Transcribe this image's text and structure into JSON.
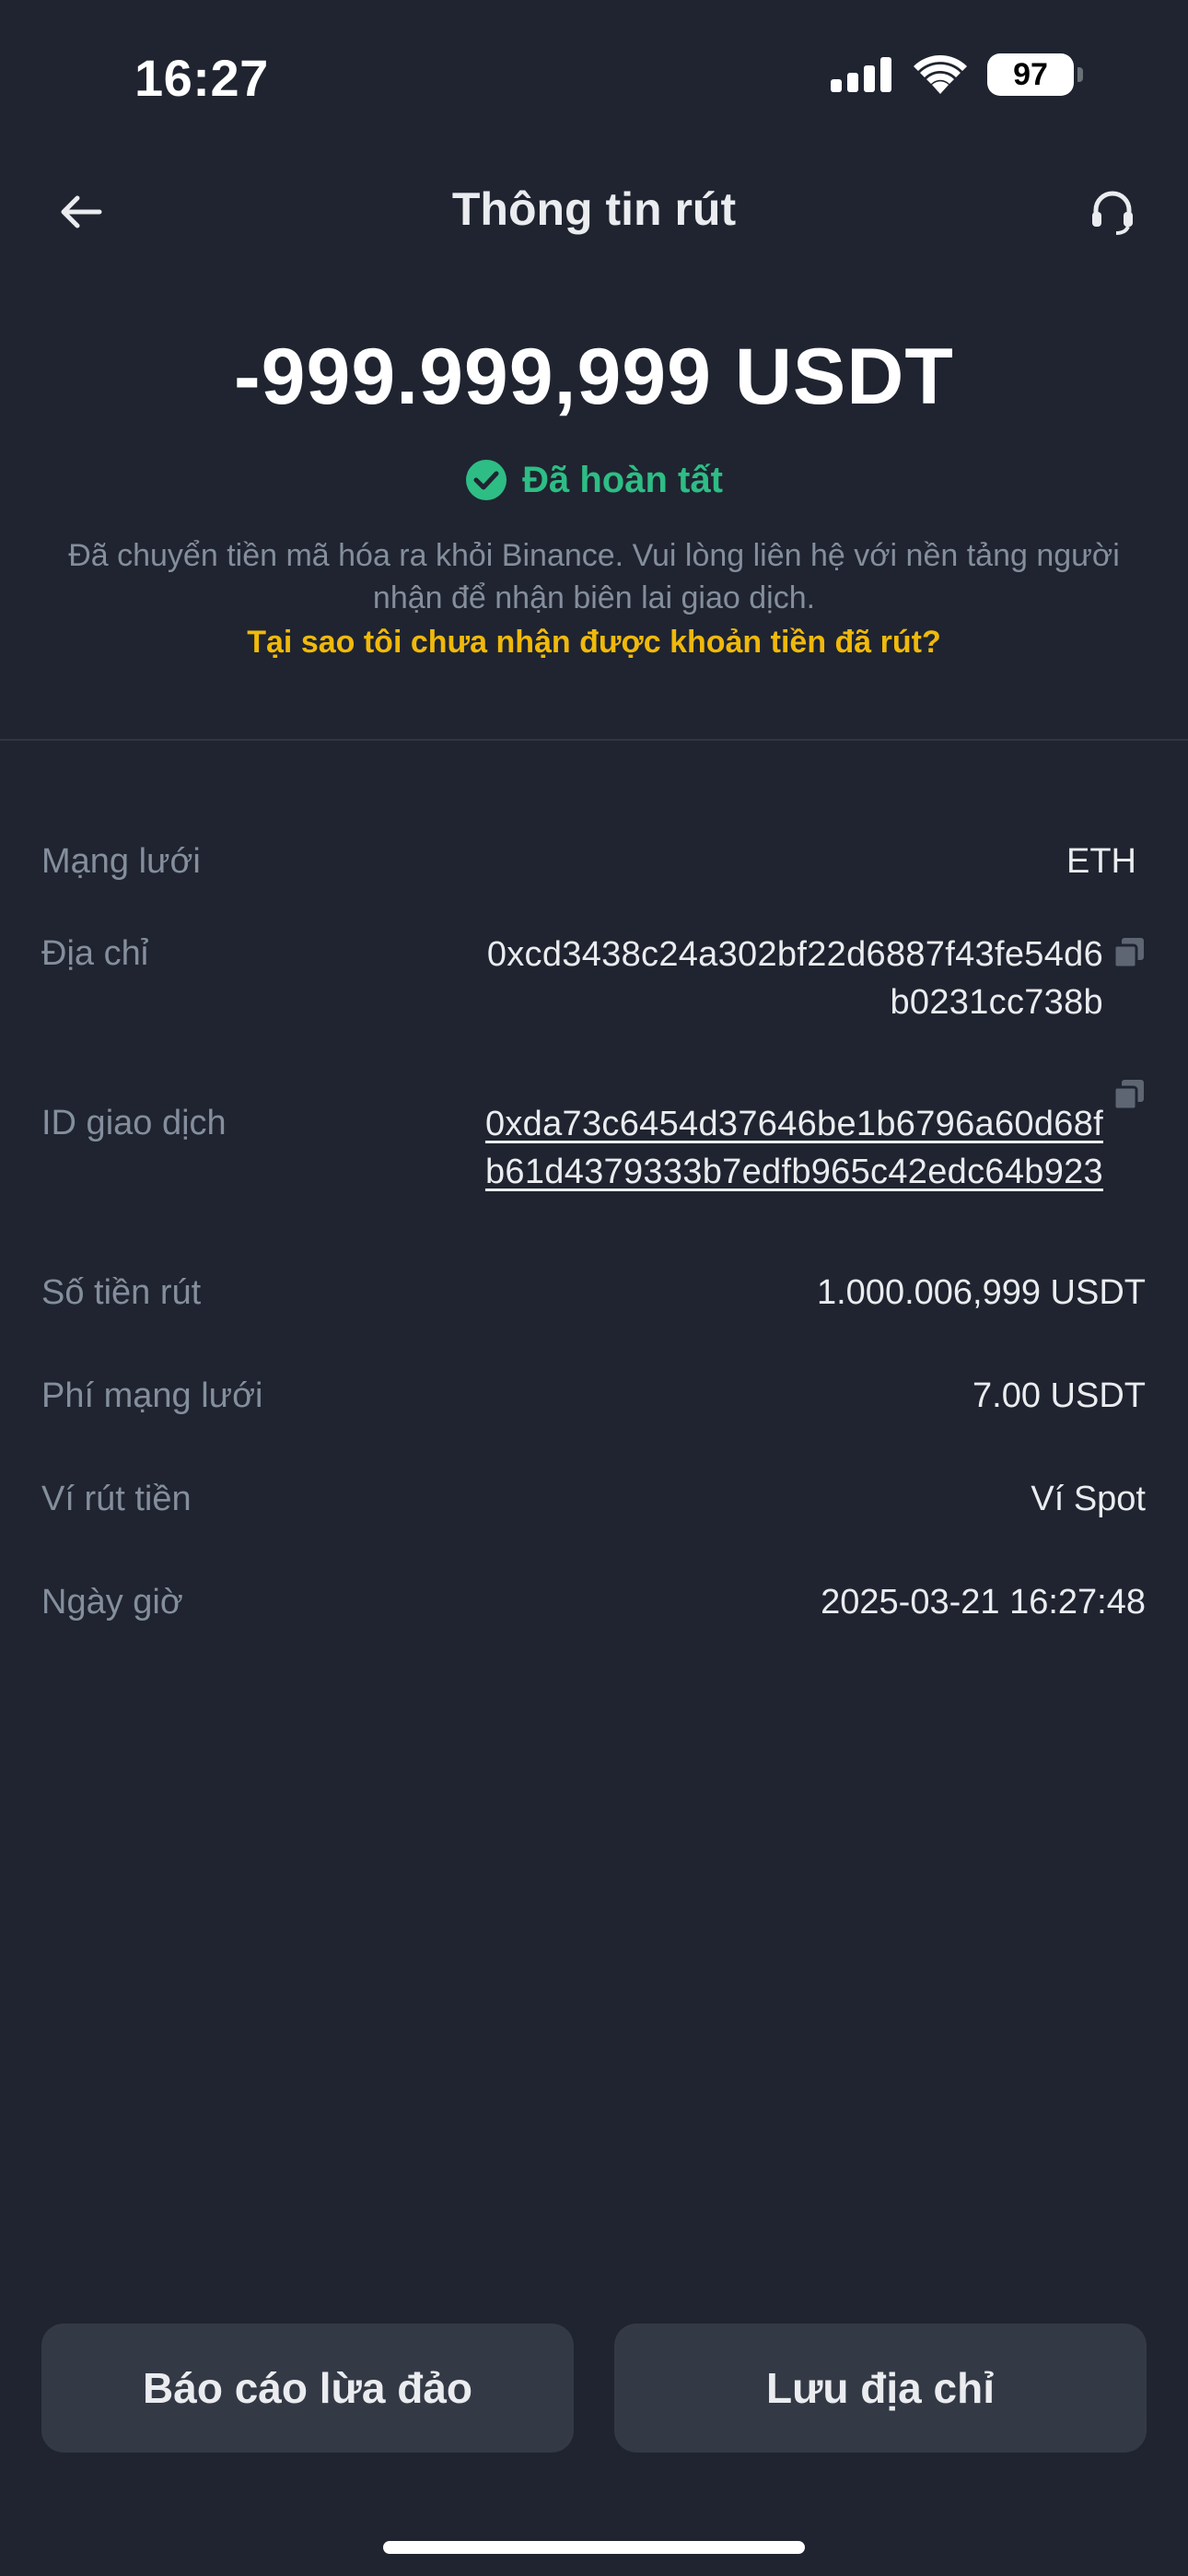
{
  "status_bar": {
    "time": "16:27",
    "battery": "97"
  },
  "header": {
    "title": "Thông tin rút",
    "back_icon": "arrow-left-icon",
    "support_icon": "headset-icon"
  },
  "summary": {
    "amount": "-999.999,999 USDT",
    "status": "Đã hoàn tất",
    "status_color": "#2ebd85",
    "description": "Đã chuyển tiền mã hóa ra khỏi Binance. Vui lòng liên hệ với nền tảng người nhận để nhận biên lai giao dịch.",
    "help_link": "Tại sao tôi chưa nhận được khoản tiền đã rút?",
    "link_color": "#f0b90b"
  },
  "details": {
    "network": {
      "label": "Mạng lưới",
      "value": "ETH"
    },
    "address": {
      "label": "Địa chỉ",
      "line1": "0xcd3438c24a302bf22d6887f43fe54d6",
      "line2": "b0231cc738b"
    },
    "txid": {
      "label": "ID giao dịch",
      "line1": "0xda73c6454d37646be1b6796a60d68f",
      "line2": "b61d4379333b7edfb965c42edc64b923"
    },
    "amount": {
      "label": "Số tiền rút",
      "value": "1.000.006,999 USDT"
    },
    "fee": {
      "label": "Phí mạng lưới",
      "value": "7.00 USDT"
    },
    "wallet": {
      "label": "Ví rút tiền",
      "value": "Ví Spot"
    },
    "datetime": {
      "label": "Ngày giờ",
      "value": "2025-03-21 16:27:48"
    }
  },
  "actions": {
    "report": "Báo cáo lừa đảo",
    "save_address": "Lưu địa chỉ"
  }
}
